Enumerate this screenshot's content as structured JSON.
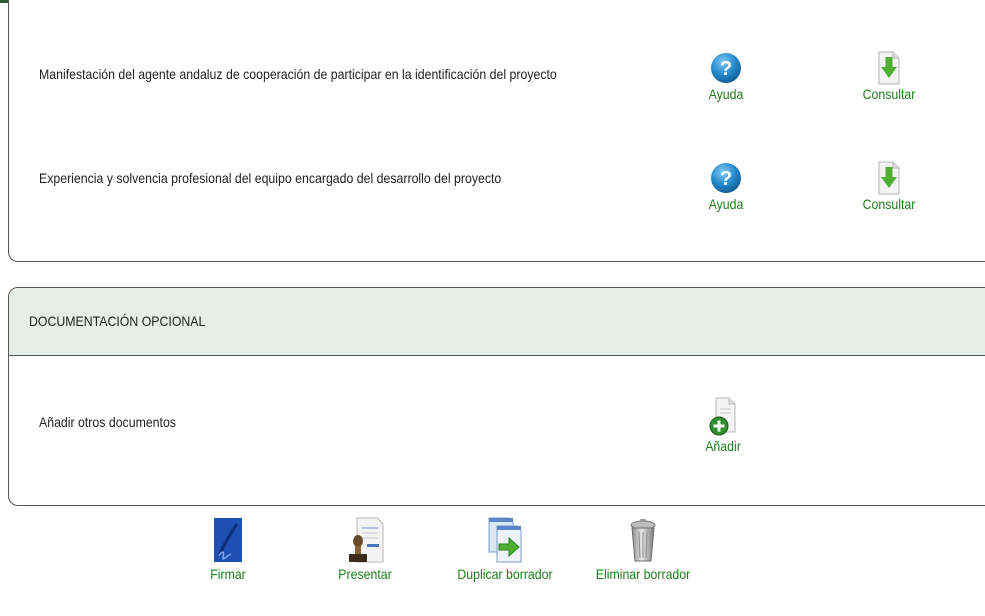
{
  "required_docs": {
    "rows": [
      {
        "label": "Manifestación del agente andaluz de cooperación de participar en la identificación del proyecto",
        "help_label": "Ayuda",
        "view_label": "Consultar"
      },
      {
        "label": "Experiencia y solvencia profesional del equipo encargado del desarrollo del proyecto",
        "help_label": "Ayuda",
        "view_label": "Consultar"
      }
    ]
  },
  "optional_docs": {
    "title": "DOCUMENTACIÓN OPCIONAL",
    "row_label": "Añadir otros documentos",
    "add_label": "Añadir"
  },
  "bottom_actions": {
    "sign": "Firmar",
    "submit": "Presentar",
    "duplicate": "Duplicar borrador",
    "delete": "Eliminar borrador"
  },
  "colors": {
    "link_green": "#1d7d1d",
    "header_bg": "#e6efe7",
    "help_blue": "#1c84c6",
    "download_green": "#4caf32"
  },
  "icons": {
    "help": "question-circle-icon",
    "view": "download-document-icon",
    "add": "add-document-icon",
    "sign": "pen-sign-icon",
    "submit": "stamp-document-icon",
    "duplicate": "copy-document-icon",
    "delete": "trash-icon"
  }
}
